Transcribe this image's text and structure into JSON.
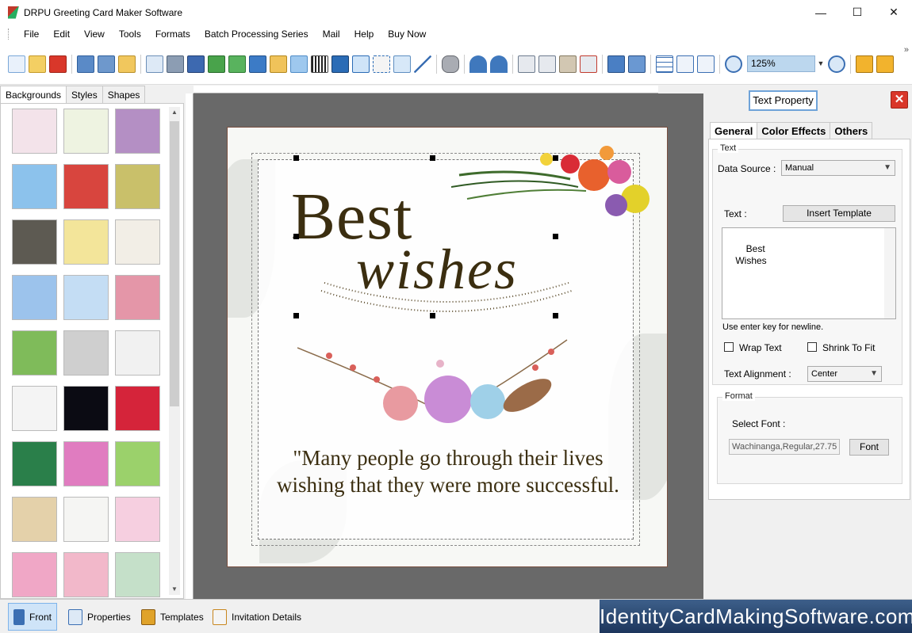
{
  "window": {
    "title": "DRPU Greeting Card Maker Software",
    "controls": {
      "minimize": "—",
      "maximize": "☐",
      "close": "✕"
    }
  },
  "menu": [
    "File",
    "Edit",
    "View",
    "Tools",
    "Formats",
    "Batch Processing Series",
    "Mail",
    "Help",
    "Buy Now"
  ],
  "toolbar": {
    "zoom_value": "125%",
    "more": "»"
  },
  "left_panel": {
    "tabs": [
      "Backgrounds",
      "Styles",
      "Shapes"
    ],
    "active_tab": "Backgrounds",
    "thumbnails": [
      "#f3e3ea",
      "#eef3e1",
      "#b48fc4",
      "#8cc2ec",
      "#d8453e",
      "#c9c06a",
      "#5d5a52",
      "#f3e59a",
      "#f2eee6",
      "#9cc3ec",
      "#c4ddf4",
      "#e496a8",
      "#7fbb5a",
      "#cfcfcf",
      "#f1f1f1",
      "#f4f4f4",
      "#0b0b13",
      "#d5243a",
      "#2a7f4a",
      "#e07cc0",
      "#9bd16b",
      "#e4d1aa",
      "#f5f5f3",
      "#f6cfe0",
      "#f0a7c6",
      "#f2b8ca",
      "#c5e0c9"
    ]
  },
  "card": {
    "line1": "Best",
    "line2": "wishes",
    "quote": "\"Many people go  through their lives  wishing that they were more successful."
  },
  "right_panel": {
    "title": "Text Property",
    "close": "✕",
    "tabs": [
      "General",
      "Color Effects",
      "Others"
    ],
    "text_group": {
      "title": "Text",
      "data_source_label": "Data Source :",
      "data_source_value": "Manual",
      "text_label": "Text :",
      "insert_template": "Insert Template",
      "text_value": "Best\n    Wishes",
      "hint": "Use enter key for newline.",
      "wrap_text": "Wrap Text",
      "shrink_to_fit": "Shrink To Fit",
      "alignment_label": "Text Alignment :",
      "alignment_value": "Center"
    },
    "format_group": {
      "title": "Format",
      "select_font_label": "Select Font :",
      "font_value": "Wachinanga,Regular,27.75",
      "font_button": "Font"
    }
  },
  "bottom": {
    "tabs": [
      "Front",
      "Properties",
      "Templates",
      "Invitation Details"
    ],
    "active_tab": "Front",
    "watermark": "IdentityCardMakingSoftware.com"
  }
}
